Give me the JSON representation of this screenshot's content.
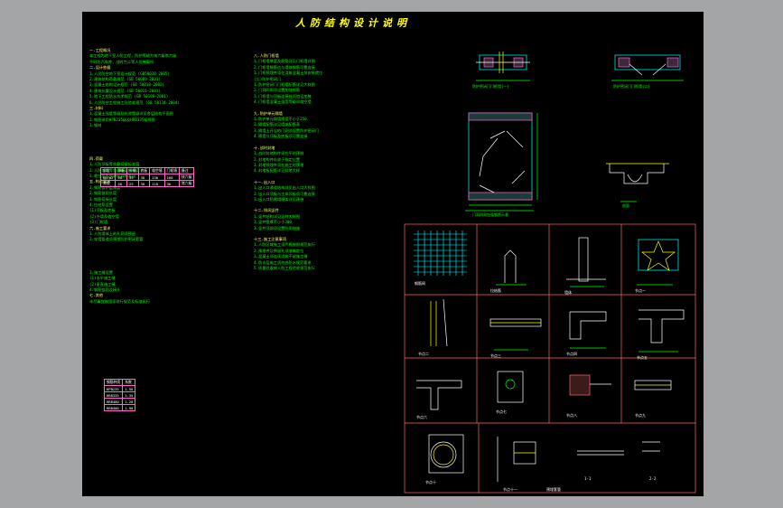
{
  "drawing": {
    "title": "人防结构设计说明",
    "left_column": [
      "一.工程概况",
      "本工程为地下室人防工程，防护等级为核六级常六级",
      "平时为汽车库，战时为二等人员掩蔽所",
      "二.设计依据",
      "1.人民防空地下室设计规范 (GB50038-2005)",
      "2.建筑结构荷载规范 (GB 50009-2001)",
      "3.混凝土结构设计规范 (GB 50010-2002)",
      "4.建筑抗震设计规范 (GB 50011-2001)",
      "5.地下工程防水技术规范 (GB 50108-2001)",
      "6.人民防空工程施工及验收规范 (GB 50134-2004)",
      "三.材料",
      "1.混凝土强度等级及抗渗等级详见各层结构平面图",
      "2.钢筋采用HPB235级及HRB335级钢筋",
      "3.钢材",
      "四.荷载",
      "1.人防顶板等效静荷载标准值",
      "2.人防外墙等效静荷载标准值",
      "3.临空墙等效静荷载标准值",
      "五.构造要求",
      "1.钢筋保护层厚度",
      "2.钢筋锚固长度",
      "3.钢筋搭接长度",
      "4.拉结筋设置",
      "(1)顶板及底板",
      "(2)外墙及临空墙",
      "(3)门框墙",
      "六.施工要求",
      "1.人防墙体上的孔洞须预留",
      "2.穿墙管道须预埋防护密闭套管",
      "3.施工缝设置",
      "(1)水平施工缝",
      "(2)垂直施工缝",
      "4.钢筋锚固及接头",
      "七.其他",
      "未尽事宜按国家现行规范及标准执行"
    ],
    "load_table": {
      "headers": [
        "部位",
        "顶板",
        "外墙",
        "底板",
        "临空墙",
        "门框墙",
        "备注"
      ],
      "rows": [
        [
          "kN/m2",
          "60",
          "35",
          "30",
          "130",
          "160",
          "核六级"
        ],
        [
          "常规",
          "50",
          "25",
          "30",
          "110",
          "36",
          "常六级"
        ]
      ]
    },
    "rebar_table": {
      "headers": [
        "钢筋种类",
        "系数"
      ],
      "rows": [
        [
          "HPB235",
          "1.50"
        ],
        [
          "HRB335",
          "1.35"
        ],
        [
          "HRB400",
          "1.20"
        ],
        [
          "RRB400",
          "1.90"
        ]
      ]
    },
    "middle_column": [
      "八.人防门框墙",
      "1.门框墙厚度及配筋详见门框墙详图",
      "2.门框墙钢筋应与墙体钢筋可靠连接",
      "3.门框预埋件须在浇筑混凝土前安装就位",
      "(二)防护密闭门",
      "1.防护密闭门门框墙配筋详见大样图",
      "2.门洞四周须设置加强钢筋",
      "3.门框墙与顶板连接处须加设加腋",
      "4.门框墙混凝土强度等级同临空墙",
      "九.防护单元隔墙",
      "1.防护单元隔墙厚度不小于250",
      "2.隔墙配筋详见墙体配筋表",
      "3.隔墙上开设的门洞须设置防护密闭门",
      "4.隔墙与顶板及底板须可靠连接",
      "十.战时封堵",
      "1.战时封堵构件须在平时预制",
      "2.封堵构件存放于指定位置",
      "3.封堵预埋件须在施工时预埋",
      "4.封堵板配筋详见封堵大样",
      "十一.出入口",
      "1.出入口通道结构详见出入口大样图",
      "2.出入口顶板与主体顶板须可靠连接",
      "3.出入口防倒塌棚架详见建施",
      "十二.排风竖井",
      "1.竖井结构详见竖井大样图",
      "2.竖井壁厚不小于300",
      "3.竖井顶部须设置防雨措施",
      "十三.施工注意事项",
      "1.人防区域施工须严格按照规范执行",
      "2.预埋件及预留孔须准确定位",
      "3.混凝土须连续浇筑不留施工缝",
      "4.防水层施工须符合防水规范要求",
      "5.质量验收按人防工程验收规范执行"
    ],
    "details": {
      "top_left_caption": "防护密闭门门框墙(一)",
      "top_right_caption": "防护密闭门门框墙(二)",
      "opening_caption": "门洞四周加强钢筋示意",
      "section_caption": "剖面",
      "grid_labels": [
        "钢筋网",
        "拉结筋",
        "墙体",
        "节点一",
        "节点二",
        "节点三",
        "节点四",
        "节点五",
        "节点六",
        "节点七",
        "节点八",
        "节点九",
        "节点十",
        "节点十一",
        "预埋套管",
        "1-1",
        "2-2"
      ]
    }
  }
}
